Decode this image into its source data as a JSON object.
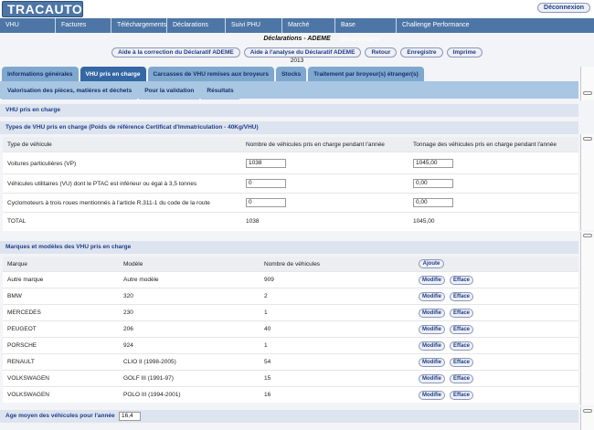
{
  "header": {
    "logo": "TRACAUTO",
    "logout": "Déconnexion"
  },
  "menu": [
    "VHU",
    "Factures",
    "Téléchargements",
    "Déclarations",
    "Suivi PHU",
    "Marché Matières",
    "Base documentaire",
    "Challenge Performance"
  ],
  "page": {
    "title": "Déclarations - ADEME",
    "year": "2013"
  },
  "actions": [
    "Aide à la correction du Déclaratif ADEME",
    "Aide à l'analyse du Déclaratif ADEME",
    "Retour",
    "Enregistre",
    "Imprime"
  ],
  "tabs": [
    "Informations générales",
    "VHU pris en charge",
    "Carcasses de VHU remises aux broyeurs",
    "Stocks",
    "Traitement par broyeur(s) étranger(s)"
  ],
  "subtabs": [
    "Valorisation des pièces, matières et déchets",
    "Pour la validation",
    "Résultats"
  ],
  "section_vhu": "VHU pris en charge",
  "types": {
    "title": "Types de VHU pris en charge (Poids de référence Certificat d'Immatriculation - 40Kg/VHU)",
    "headers": [
      "Type de véhicule",
      "Nombre de véhicules pris en charge pendant l'année",
      "Tonnage des véhicules pris en charge pendant l'année"
    ],
    "rows": [
      {
        "type": "Voitures particulières (VP)",
        "count": "1038",
        "tonnage": "1045,00"
      },
      {
        "type": "Véhicules utilitaires (VU) dont le PTAC est inférieur ou égal à 3,5 tonnes",
        "count": "0",
        "tonnage": "0,00"
      },
      {
        "type": "Cyclomoteurs à trois roues mentionnés à l'article R.311-1 du code de la route",
        "count": "0",
        "tonnage": "0,00"
      }
    ],
    "total": {
      "label": "TOTAL",
      "count": "1038",
      "tonnage": "1045,00"
    }
  },
  "brands": {
    "title": "Marques et modèles des VHU pris en charge",
    "headers": [
      "Marque",
      "Modèle",
      "Nombre de véhicules"
    ],
    "add_label": "Ajoute",
    "edit_label": "Modifie",
    "delete_label": "Efface",
    "rows": [
      {
        "brand": "Autre marque",
        "model": "Autre modèle",
        "count": "909"
      },
      {
        "brand": "BMW",
        "model": "320",
        "count": "2"
      },
      {
        "brand": "MERCEDES",
        "model": "230",
        "count": "1"
      },
      {
        "brand": "PEUGEOT",
        "model": "206",
        "count": "40"
      },
      {
        "brand": "PORSCHE",
        "model": "924",
        "count": "1"
      },
      {
        "brand": "RENAULT",
        "model": "CLIO II (1998-2005)",
        "count": "54"
      },
      {
        "brand": "VOLKSWAGEN",
        "model": "GOLF III (1991-97)",
        "count": "15"
      },
      {
        "brand": "VOLKSWAGEN",
        "model": "POLO III (1994-2001)",
        "count": "16"
      }
    ]
  },
  "age": {
    "label": "Age moyen des véhicules pour l'année",
    "value": "16,4"
  }
}
